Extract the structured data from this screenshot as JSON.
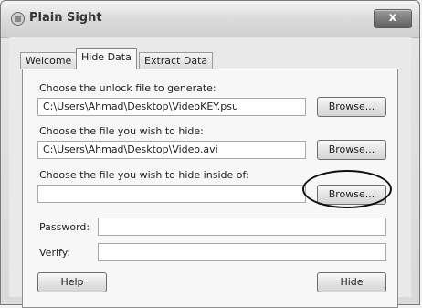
{
  "window": {
    "title": "Plain Sight",
    "close_label": "x"
  },
  "tabs": [
    {
      "label": "Welcome",
      "active": false
    },
    {
      "label": "Hide Data",
      "active": true
    },
    {
      "label": "Extract Data",
      "active": false
    }
  ],
  "form": {
    "unlock_label": "Choose the unlock file to generate:",
    "unlock_value": "C:\\Users\\Ahmad\\Desktop\\VideoKEY.psu",
    "hide_file_label": "Choose the file you wish to hide:",
    "hide_file_value": "C:\\Users\\Ahmad\\Desktop\\Video.avi",
    "carrier_label": "Choose the file you wish to hide inside of:",
    "carrier_value": "",
    "browse_label": "Browse...",
    "password_label": "Password:",
    "password_value": "",
    "verify_label": "Verify:",
    "verify_value": ""
  },
  "footer": {
    "help_label": "Help",
    "hide_label": "Hide"
  }
}
